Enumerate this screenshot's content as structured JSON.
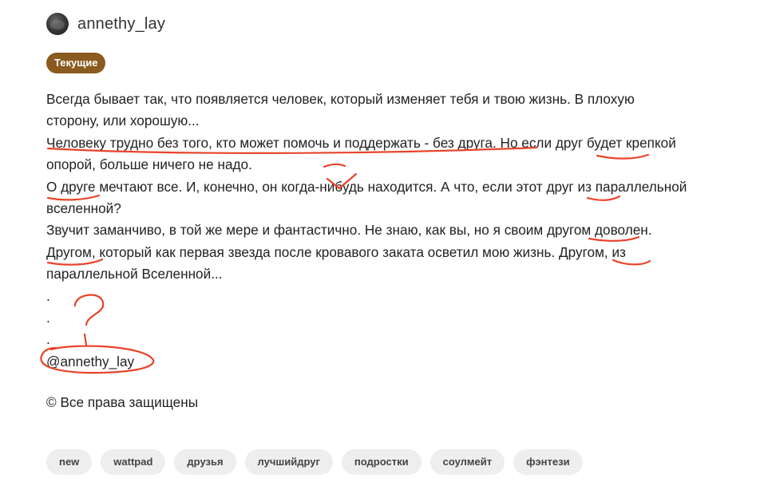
{
  "author": {
    "name": "annethy_lay"
  },
  "badge": {
    "label": "Текущие"
  },
  "story": {
    "lines": [
      "Всегда бывает так, что появляется человек, который изменяет тебя и твою жизнь. В плохую",
      "сторону, или хорошую...",
      "Человеку трудно без того, кто может помочь и поддержать - без друга. Но если друг будет крепкой",
      "опорой, больше ничего не надо.",
      "О друге мечтают все. И, конечно, он когда-нибудь находится. А что, если этот друг из параллельной",
      "вселенной?",
      "Звучит заманчиво, в той же мере и фантастично. Не знаю, как вы, но я своим другом доволен.",
      "Другом, который как первая звезда после кровавого заката осветил мою жизнь. Другом, из",
      "параллельной Вселенной...",
      ".",
      ".",
      ".",
      "@annethy_lay"
    ]
  },
  "footer": {
    "rights": "© Все права защищены"
  },
  "tags": [
    "new",
    "wattpad",
    "друзья",
    "лучшийдруг",
    "подростки",
    "соулмейт",
    "фэнтези"
  ],
  "colors": {
    "accent": "#8a5a1e",
    "annotation": "#e8432a",
    "tag_bg": "#eeeeee"
  }
}
